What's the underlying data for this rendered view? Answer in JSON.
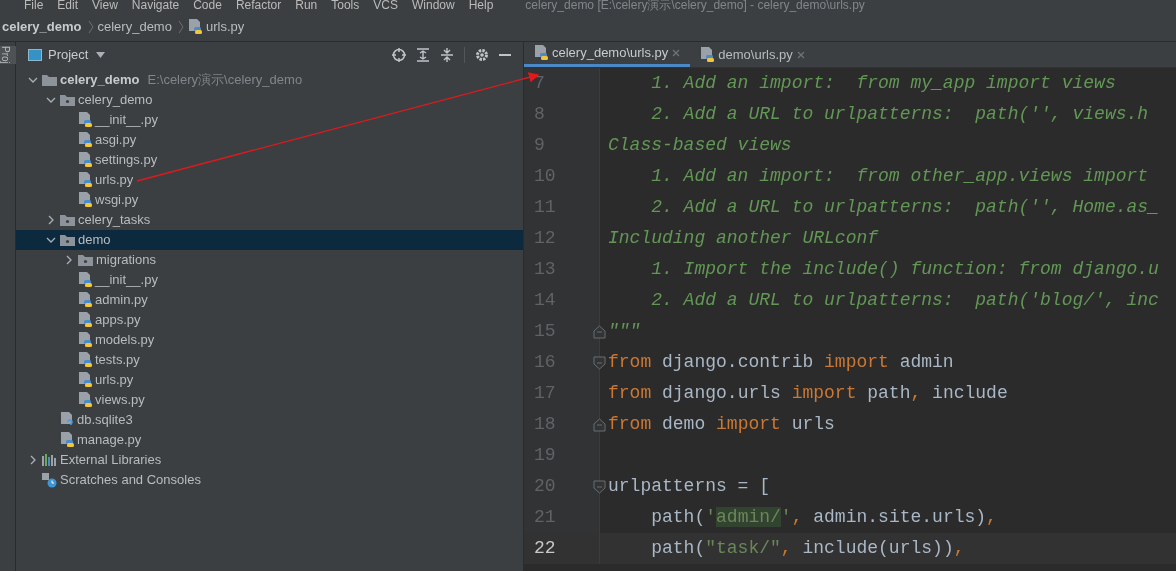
{
  "menu": [
    "File",
    "Edit",
    "View",
    "Navigate",
    "Code",
    "Refactor",
    "Run",
    "Tools",
    "VCS",
    "Window",
    "Help"
  ],
  "window_title": "celery_demo [E:\\celery演示\\celery_demo] - celery_demo\\urls.py",
  "breadcrumbs": [
    {
      "label": "celery_demo",
      "kind": "project"
    },
    {
      "label": "celery_demo",
      "kind": "folder"
    },
    {
      "label": "urls.py",
      "kind": "python"
    }
  ],
  "side_tab": "Proj",
  "project_panel": {
    "title": "Project",
    "tree": [
      {
        "label": "celery_demo",
        "path": "E:\\celery演示\\celery_demo",
        "kind": "folder",
        "expanded": true,
        "selected": false,
        "children": [
          {
            "label": "celery_demo",
            "kind": "package",
            "expanded": true,
            "selected": false,
            "children": [
              {
                "label": "__init__.py",
                "kind": "python",
                "selected": false
              },
              {
                "label": "asgi.py",
                "kind": "python",
                "selected": false
              },
              {
                "label": "settings.py",
                "kind": "python",
                "selected": false
              },
              {
                "label": "urls.py",
                "kind": "python",
                "selected": false
              },
              {
                "label": "wsgi.py",
                "kind": "python",
                "selected": false
              }
            ]
          },
          {
            "label": "celery_tasks",
            "kind": "package",
            "expanded": false,
            "selected": false
          },
          {
            "label": "demo",
            "kind": "package",
            "expanded": true,
            "selected": true,
            "children": [
              {
                "label": "migrations",
                "kind": "package",
                "expanded": false,
                "selected": false
              },
              {
                "label": "__init__.py",
                "kind": "python",
                "selected": false
              },
              {
                "label": "admin.py",
                "kind": "python",
                "selected": false
              },
              {
                "label": "apps.py",
                "kind": "python",
                "selected": false
              },
              {
                "label": "models.py",
                "kind": "python",
                "selected": false
              },
              {
                "label": "tests.py",
                "kind": "python",
                "selected": false
              },
              {
                "label": "urls.py",
                "kind": "python",
                "selected": false
              },
              {
                "label": "views.py",
                "kind": "python",
                "selected": false
              }
            ]
          },
          {
            "label": "db.sqlite3",
            "kind": "unknown",
            "selected": false
          },
          {
            "label": "manage.py",
            "kind": "python",
            "selected": false
          }
        ]
      },
      {
        "label": "External Libraries",
        "kind": "libraries",
        "expanded": false,
        "selected": false
      },
      {
        "label": "Scratches and Consoles",
        "kind": "scratches",
        "selected": false
      }
    ]
  },
  "editor_tabs": [
    {
      "label": "celery_demo\\urls.py",
      "selected": true
    },
    {
      "label": "demo\\urls.py",
      "selected": false
    }
  ],
  "code_lines": [
    {
      "number": "7",
      "current": false,
      "tokens": [
        {
          "kind": "doc",
          "text": "    1. Add an import:  from my_app import views"
        }
      ]
    },
    {
      "number": "8",
      "current": false,
      "tokens": [
        {
          "kind": "doc",
          "text": "    2. Add a URL to urlpatterns:  path('', views.h"
        }
      ]
    },
    {
      "number": "9",
      "current": false,
      "tokens": [
        {
          "kind": "doc",
          "text": "Class-based views"
        }
      ]
    },
    {
      "number": "10",
      "current": false,
      "tokens": [
        {
          "kind": "doc",
          "text": "    1. Add an import:  from other_app.views import"
        }
      ]
    },
    {
      "number": "11",
      "current": false,
      "tokens": [
        {
          "kind": "doc",
          "text": "    2. Add a URL to urlpatterns:  path('', Home.as_"
        }
      ]
    },
    {
      "number": "12",
      "current": false,
      "tokens": [
        {
          "kind": "doc",
          "text": "Including another URLconf"
        }
      ]
    },
    {
      "number": "13",
      "current": false,
      "tokens": [
        {
          "kind": "doc",
          "text": "    1. Import the include() function: from django.u"
        }
      ]
    },
    {
      "number": "14",
      "current": false,
      "tokens": [
        {
          "kind": "doc",
          "text": "    2. Add a URL to urlpatterns:  path('blog/', inc"
        }
      ]
    },
    {
      "number": "15",
      "current": false,
      "kind": "fold_end",
      "tokens": [
        {
          "kind": "doc",
          "text": "\"\"\""
        }
      ]
    },
    {
      "number": "16",
      "current": false,
      "kind": "fold_start",
      "tokens": [
        {
          "kind": "keyword",
          "text": "from"
        },
        {
          "kind": "plain",
          "text": " django.contrib "
        },
        {
          "kind": "keyword",
          "text": "import"
        },
        {
          "kind": "plain",
          "text": " admin"
        }
      ]
    },
    {
      "number": "17",
      "current": false,
      "tokens": [
        {
          "kind": "keyword",
          "text": "from"
        },
        {
          "kind": "plain",
          "text": " django.urls "
        },
        {
          "kind": "keyword",
          "text": "import"
        },
        {
          "kind": "plain",
          "text": " path"
        },
        {
          "kind": "keyword",
          "text": ","
        },
        {
          "kind": "plain",
          "text": " include"
        }
      ]
    },
    {
      "number": "18",
      "current": false,
      "kind": "fold_end",
      "tokens": [
        {
          "kind": "keyword",
          "text": "from"
        },
        {
          "kind": "plain",
          "text": " demo "
        },
        {
          "kind": "keyword",
          "text": "import"
        },
        {
          "kind": "plain",
          "text": " urls"
        }
      ]
    },
    {
      "number": "19",
      "current": false
    },
    {
      "number": "20",
      "current": false,
      "kind": "fold_start",
      "tokens": [
        {
          "kind": "plain",
          "text": "urlpatterns = ["
        }
      ]
    },
    {
      "number": "21",
      "current": false,
      "tokens": [
        {
          "kind": "plain",
          "text": "    path("
        },
        {
          "kind": "string",
          "text": "'"
        },
        {
          "kind": "match",
          "text": "admin/"
        },
        {
          "kind": "string",
          "text": "'"
        },
        {
          "kind": "keyword",
          "text": ","
        },
        {
          "kind": "plain",
          "text": " admin.site.urls)"
        },
        {
          "kind": "keyword",
          "text": ","
        }
      ]
    },
    {
      "number": "22",
      "current": true,
      "tokens": [
        {
          "kind": "plain",
          "text": "    path("
        },
        {
          "kind": "string",
          "text": "\"task/\""
        },
        {
          "kind": "keyword",
          "text": ","
        },
        {
          "kind": "plain",
          "text": " include(urls))"
        },
        {
          "kind": "keyword",
          "text": ","
        }
      ]
    }
  ]
}
